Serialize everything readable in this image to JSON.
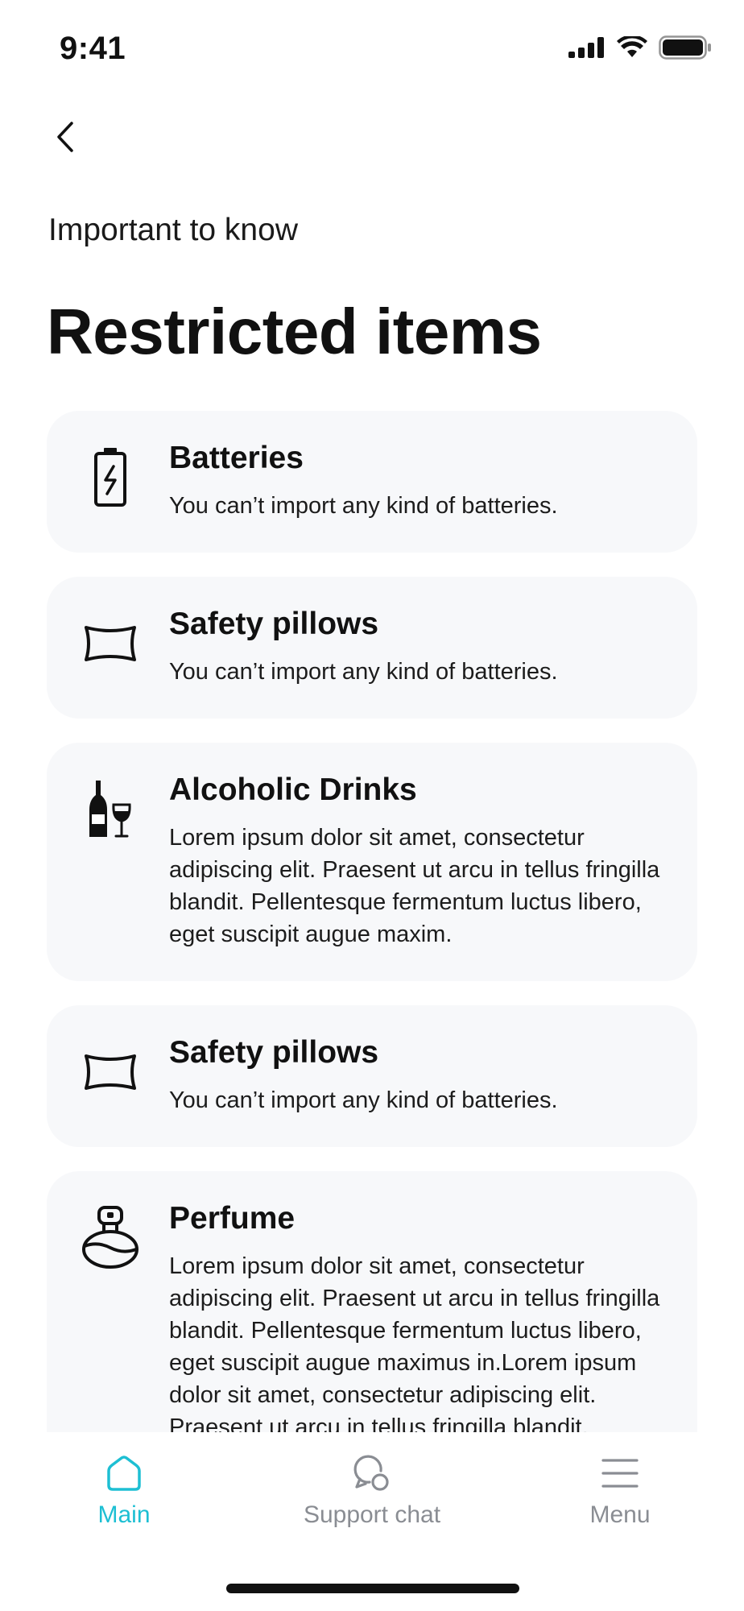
{
  "status": {
    "time": "9:41"
  },
  "header": {
    "back_icon": "chevron-left-icon",
    "subtitle": "Important to know",
    "title": "Restricted items"
  },
  "items": [
    {
      "icon": "battery-icon",
      "title": "Batteries",
      "description": "You can’t import any kind of batteries."
    },
    {
      "icon": "pillow-icon",
      "title": "Safety pillows",
      "description": "You can’t import any kind of batteries."
    },
    {
      "icon": "wine-icon",
      "title": "Alcoholic Drinks",
      "description": "Lorem ipsum dolor sit amet, consectetur adipiscing elit. Praesent ut arcu in tellus fringilla blandit. Pellentesque fermentum luctus libero, eget suscipit augue maxim."
    },
    {
      "icon": "pillow-icon",
      "title": "Safety pillows",
      "description": "You can’t import any kind of batteries."
    },
    {
      "icon": "perfume-icon",
      "title": "Perfume",
      "description": "Lorem ipsum dolor sit amet, consectetur adipiscing elit. Praesent ut arcu in tellus fringilla blandit. Pellentesque fermentum luctus libero, eget suscipit augue maximus in.Lorem ipsum dolor sit amet, consectetur adipiscing elit. Praesent ut arcu in tellus fringilla blandit. Pellentesque fermentum"
    }
  ],
  "tabs": [
    {
      "label": "Main",
      "icon": "home-icon",
      "active": true
    },
    {
      "label": "Support chat",
      "icon": "chat-icon",
      "active": false
    },
    {
      "label": "Menu",
      "icon": "menu-icon",
      "active": false
    }
  ],
  "colors": {
    "accent": "#1dbfd3",
    "card_bg": "#f7f8fa",
    "inactive": "#8a8d93"
  }
}
